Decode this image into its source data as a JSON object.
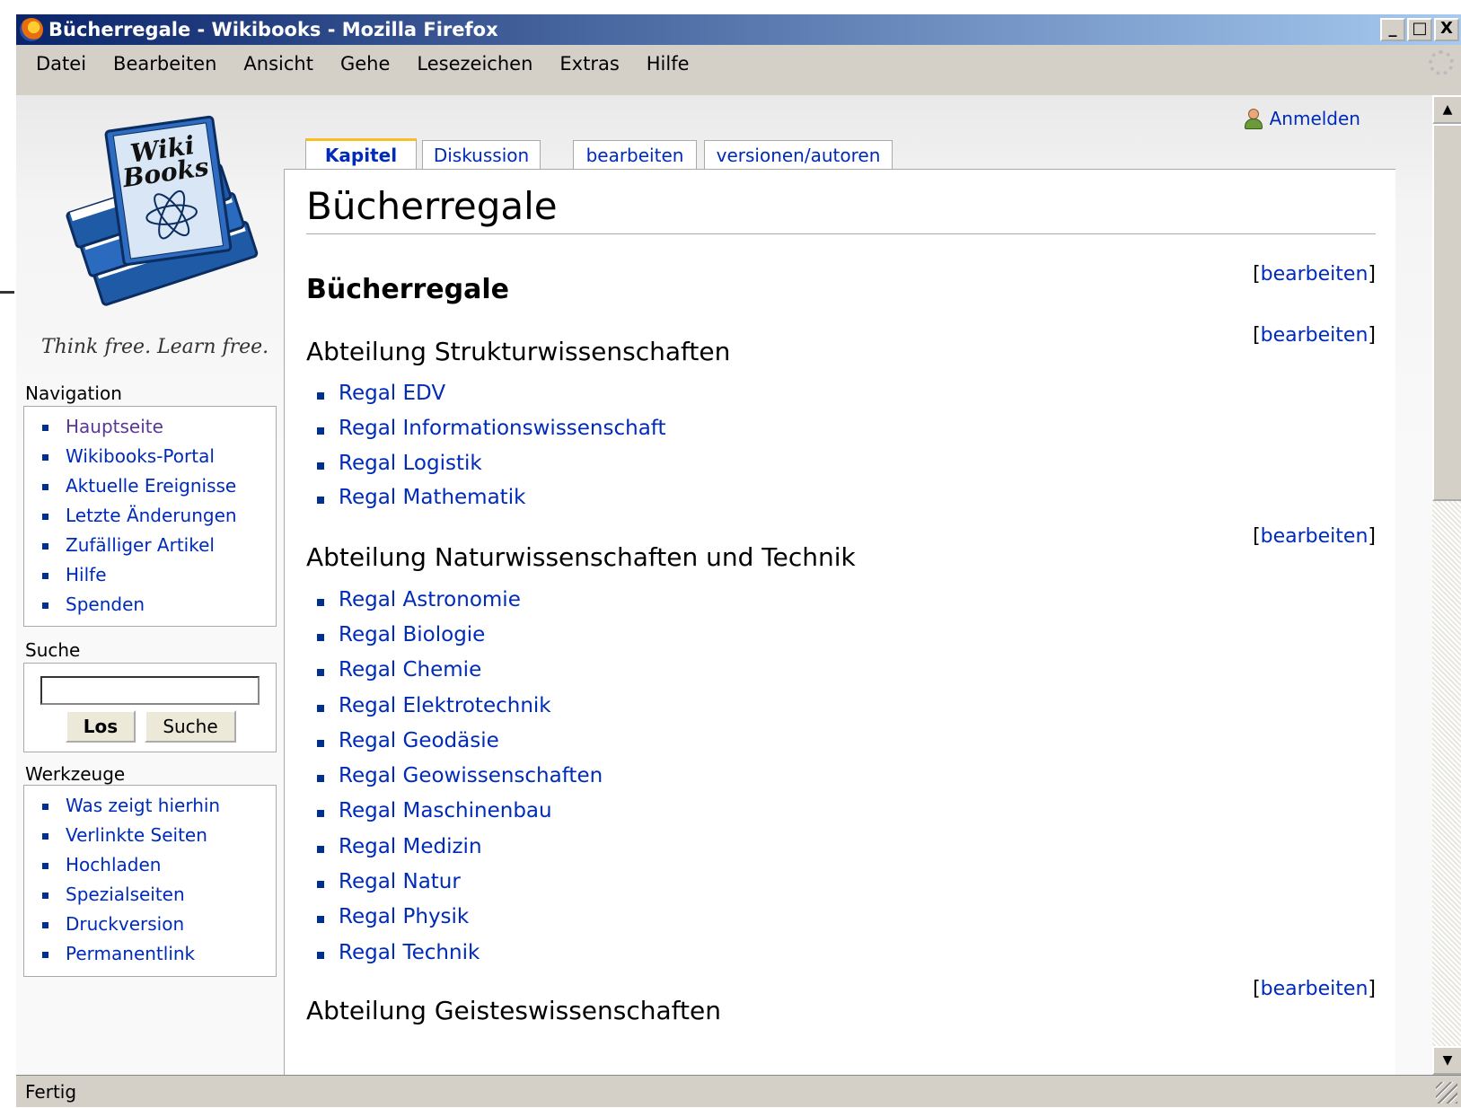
{
  "window": {
    "title": "Bücherregale - Wikibooks - Mozilla Firefox",
    "buttons": [
      "_",
      "□",
      "X"
    ]
  },
  "menubar": {
    "items": [
      "Datei",
      "Bearbeiten",
      "Ansicht",
      "Gehe",
      "Lesezeichen",
      "Extras",
      "Hilfe"
    ]
  },
  "logo": {
    "text_line1": "Wiki",
    "text_line2": "Books",
    "tagline": "Think free. Learn free."
  },
  "user": {
    "login_label": "Anmelden"
  },
  "tabs": [
    {
      "label": "Kapitel",
      "selected": true
    },
    {
      "label": "Diskussion",
      "selected": false
    },
    {
      "label": "bearbeiten",
      "selected": false
    },
    {
      "label": "versionen/autoren",
      "selected": false
    }
  ],
  "navigation": {
    "title": "Navigation",
    "items": [
      "Hauptseite",
      "Wikibooks-Portal",
      "Aktuelle Ereignisse",
      "Letzte Änderungen",
      "Zufälliger Artikel",
      "Hilfe",
      "Spenden"
    ]
  },
  "search": {
    "title": "Suche",
    "value": "",
    "go_label": "Los",
    "search_label": "Suche"
  },
  "tools": {
    "title": "Werkzeuge",
    "items": [
      "Was zeigt hierhin",
      "Verlinkte Seiten",
      "Hochladen",
      "Spezialseiten",
      "Druckversion",
      "Permanentlink"
    ]
  },
  "page": {
    "title": "Bücherregale",
    "h2": "Bücherregale",
    "edit_link": "bearbeiten",
    "sections": [
      {
        "heading": "Abteilung Strukturwissenschaften",
        "items": [
          "Regal EDV",
          "Regal Informationswissenschaft",
          "Regal Logistik",
          "Regal Mathematik"
        ]
      },
      {
        "heading": "Abteilung Naturwissenschaften und Technik",
        "items": [
          "Regal Astronomie",
          "Regal Biologie",
          "Regal Chemie",
          "Regal Elektrotechnik",
          "Regal Geodäsie",
          "Regal Geowissenschaften",
          "Regal Maschinenbau",
          "Regal Medizin",
          "Regal Natur",
          "Regal Physik",
          "Regal Technik"
        ]
      },
      {
        "heading": "Abteilung Geisteswissenschaften",
        "items": []
      }
    ]
  },
  "status": {
    "text": "Fertig"
  },
  "colors": {
    "link": "#002bb8",
    "visited_link": "#5a3696",
    "titlebar_start": "#0a246a",
    "tab_accent": "#fabd23"
  }
}
